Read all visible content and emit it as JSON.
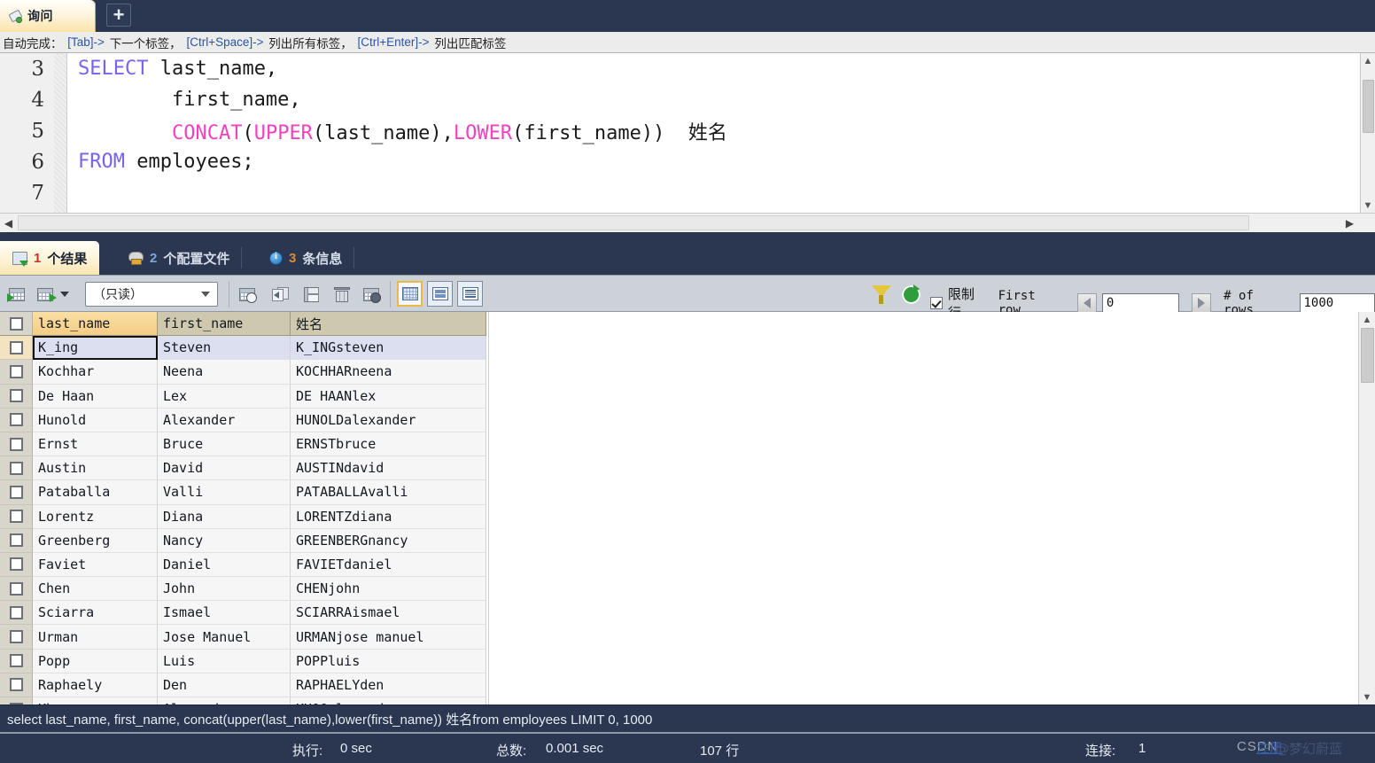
{
  "window": {
    "query_tab_label": "询问",
    "new_tab_label": "+"
  },
  "hint": {
    "prefix": "自动完成：",
    "item1_key": "[Tab]->",
    "item1_text": "下一个标签，",
    "item2_key": "[Ctrl+Space]->",
    "item2_text": "列出所有标签，",
    "item3_key": "[Ctrl+Enter]->",
    "item3_text": "列出匹配标签"
  },
  "editor": {
    "lines": [
      {
        "no": "3",
        "parts": [
          {
            "t": "SELECT",
            "c": "kw"
          },
          {
            "t": " last_name,",
            "c": "plain"
          }
        ]
      },
      {
        "no": "4",
        "parts": [
          {
            "t": "        first_name,",
            "c": "plain"
          }
        ]
      },
      {
        "no": "5",
        "parts": [
          {
            "t": "        ",
            "c": "plain"
          },
          {
            "t": "CONCAT",
            "c": "fn"
          },
          {
            "t": "(",
            "c": "plain"
          },
          {
            "t": "UPPER",
            "c": "fn"
          },
          {
            "t": "(last_name),",
            "c": "plain"
          },
          {
            "t": "LOWER",
            "c": "fn"
          },
          {
            "t": "(first_name))  ",
            "c": "plain"
          },
          {
            "t": "姓名",
            "c": "cjk"
          }
        ]
      },
      {
        "no": "6",
        "parts": [
          {
            "t": "FROM",
            "c": "kw"
          },
          {
            "t": " employees;",
            "c": "plain"
          }
        ]
      },
      {
        "no": "7",
        "parts": [
          {
            "t": "",
            "c": "plain"
          }
        ]
      }
    ],
    "line_numbers": [
      "3",
      "4",
      "5",
      "6",
      "7"
    ],
    "l3_kw": "SELECT",
    "l3_rest": " last_name,",
    "l4_rest": "        first_name,",
    "l5_indent": "        ",
    "l5_fn1": "CONCAT",
    "l5_p1": "(",
    "l5_fn2": "UPPER",
    "l5_p2": "(last_name),",
    "l5_fn3": "LOWER",
    "l5_p3": "(first_name))  ",
    "l5_alias": "姓名",
    "l6_kw": "FROM",
    "l6_rest": " employees;",
    "l7_rest": ""
  },
  "result_tabs": [
    {
      "num": "1",
      "label": "个结果",
      "icon": "result-grid-icon",
      "active": true
    },
    {
      "num": "2",
      "label": "个配置文件",
      "icon": "profile-icon",
      "active": false
    },
    {
      "num": "3",
      "label": "条信息",
      "icon": "info-icon",
      "active": false
    }
  ],
  "grid_toolbar": {
    "edit_mode_value": "（只读）",
    "icons": [
      "grid-insert-row-icon",
      "grid-export-icon",
      "dropdown-caret-icon",
      "add-row-icon",
      "revert-icon",
      "save-icon",
      "delete-row-icon",
      "cancel-edit-icon",
      "view-grid-icon",
      "view-form-icon",
      "view-text-icon",
      "filter-icon",
      "refresh-icon"
    ],
    "limit_checkbox_label": "限制行",
    "first_row_label": "First row",
    "first_row_value": "0",
    "rows_label": "# of rows",
    "rows_value": "1000"
  },
  "table": {
    "columns": [
      "last_name",
      "first_name",
      "姓名"
    ],
    "rows": [
      [
        "K_ing",
        "Steven",
        "K_INGsteven"
      ],
      [
        "Kochhar",
        "Neena",
        "KOCHHARneena"
      ],
      [
        "De Haan",
        "Lex",
        "DE HAANlex"
      ],
      [
        "Hunold",
        "Alexander",
        "HUNOLDalexander"
      ],
      [
        "Ernst",
        "Bruce",
        "ERNSTbruce"
      ],
      [
        "Austin",
        "David",
        "AUSTINdavid"
      ],
      [
        "Pataballa",
        "Valli",
        "PATABALLAvalli"
      ],
      [
        "Lorentz",
        "Diana",
        "LORENTZdiana"
      ],
      [
        "Greenberg",
        "Nancy",
        "GREENBERGnancy"
      ],
      [
        "Faviet",
        "Daniel",
        "FAVIETdaniel"
      ],
      [
        "Chen",
        "John",
        "CHENjohn"
      ],
      [
        "Sciarra",
        "Ismael",
        "SCIARRAismael"
      ],
      [
        "Urman",
        "Jose Manuel",
        "URMANjose manuel"
      ],
      [
        "Popp",
        "Luis",
        "POPPluis"
      ],
      [
        "Raphaely",
        "Den",
        "RAPHAELYden"
      ],
      [
        "Khoo",
        "Alexander",
        "KHOOalexander"
      ]
    ]
  },
  "sql_status": "select last_name,      first_name,      concat(upper(last_name),lower(first_name)) 姓名from employees LIMIT 0, 1000",
  "status_bar": {
    "exec_label": "执行:",
    "exec_value": "0 sec",
    "total_label": "总数:",
    "total_value": "0.001 sec",
    "rows": "107 行",
    "connection_label": "连接:",
    "connection_value": "1"
  },
  "watermark": {
    "brand": "CSDN",
    "link": "注册",
    "handle": "@梦幻蔚蓝"
  },
  "colors": {
    "chrome_dark": "#2b3750",
    "tab_active": "#fbe5ad",
    "keyword": "#7a62f0",
    "function": "#f43fc0",
    "header_cell": "#cec9ae",
    "selected_row": "#dcdff0"
  }
}
